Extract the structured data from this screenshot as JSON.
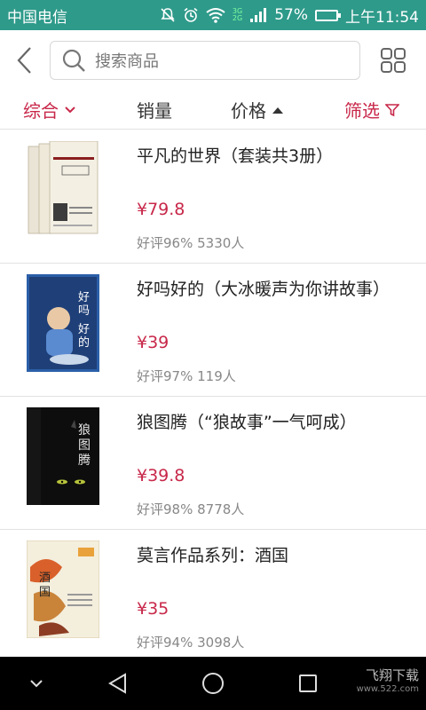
{
  "status_bar": {
    "carrier": "中国电信",
    "battery": "57%",
    "battery_level": 0.57,
    "time": "上午11:54",
    "net_top": "3G",
    "net_bottom": "2G"
  },
  "search": {
    "placeholder": "搜索商品"
  },
  "sort_bar": {
    "comprehensive": "综合",
    "sales": "销量",
    "price": "价格",
    "filter": "筛选"
  },
  "products": [
    {
      "title": "平凡的世界（套装共3册）",
      "price": "¥79.8",
      "review": "好评96% 5330人"
    },
    {
      "title": "好吗好的（大冰暖声为你讲故事）",
      "price": "¥39",
      "review": "好评97% 119人"
    },
    {
      "title": "狼图腾（“狼故事”一气呵成）",
      "price": "¥39.8",
      "review": "好评98% 8778人"
    },
    {
      "title": "莫言作品系列：酒国",
      "price": "¥35",
      "review": "好评94% 3098人"
    }
  ],
  "covers": {
    "book2_text": "好吗好的",
    "book3_text": "狼图腾",
    "book4_text": "酒国"
  },
  "watermark": {
    "line1": "飞翔下载",
    "line2": "www.522.com"
  },
  "colors": {
    "status_bar": "#2e9a8a",
    "accent": "#c8284a"
  }
}
